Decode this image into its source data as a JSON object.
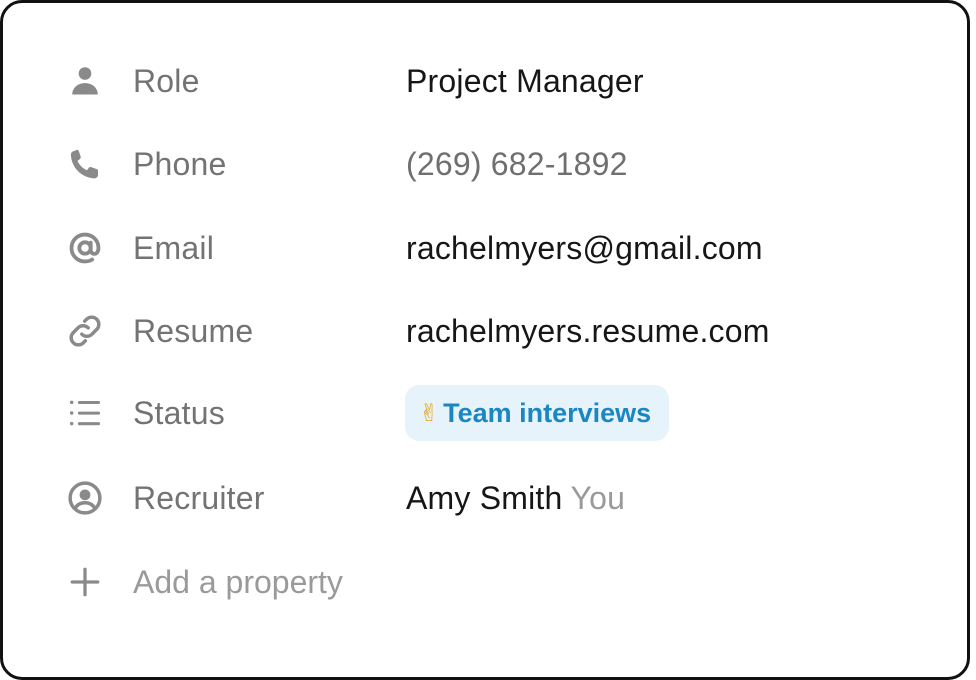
{
  "properties": {
    "role": {
      "label": "Role",
      "value": "Project Manager",
      "icon": "person-icon"
    },
    "phone": {
      "label": "Phone",
      "value": "(269) 682-1892",
      "icon": "phone-icon"
    },
    "email": {
      "label": "Email",
      "value": "rachelmyers@gmail.com",
      "icon": "at-icon"
    },
    "resume": {
      "label": "Resume",
      "value": "rachelmyers.resume.com",
      "icon": "link-icon"
    },
    "status": {
      "label": "Status",
      "value": "Team interviews",
      "emoji": "✌",
      "icon": "list-icon"
    },
    "recruiter": {
      "label": "Recruiter",
      "value": "Amy Smith",
      "suffix": "You",
      "icon": "user-circle-icon"
    }
  },
  "add_property": {
    "label": "Add a property",
    "icon": "plus-icon"
  },
  "colors": {
    "label": "#737373",
    "value": "#161616",
    "status_bg": "#e6f3fb",
    "status_text": "#1a86c2"
  }
}
